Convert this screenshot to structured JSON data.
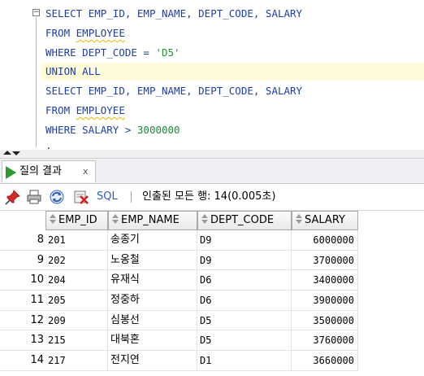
{
  "editor": {
    "lines": [
      {
        "segments": [
          {
            "t": "SELECT ",
            "c": "kw"
          },
          {
            "t": "EMP_ID, EMP_NAME, DEPT_CODE, SALARY",
            "c": "id"
          }
        ]
      },
      {
        "segments": [
          {
            "t": "FROM ",
            "c": "kw"
          },
          {
            "t": "EMPLOYEE",
            "c": "id squig"
          }
        ]
      },
      {
        "segments": [
          {
            "t": "WHERE ",
            "c": "kw"
          },
          {
            "t": "DEPT_CODE = ",
            "c": "id"
          },
          {
            "t": "'D5'",
            "c": "str"
          }
        ]
      },
      {
        "segments": [
          {
            "t": "UNION ALL",
            "c": "kw"
          }
        ],
        "highlight": true
      },
      {
        "segments": [
          {
            "t": "SELECT ",
            "c": "kw"
          },
          {
            "t": "EMP_ID, EMP_NAME, DEPT_CODE, SALARY",
            "c": "id"
          }
        ]
      },
      {
        "segments": [
          {
            "t": "FROM ",
            "c": "kw"
          },
          {
            "t": "EMPLOYEE",
            "c": "id squig"
          }
        ]
      },
      {
        "segments": [
          {
            "t": "WHERE ",
            "c": "kw"
          },
          {
            "t": "SALARY > ",
            "c": "id"
          },
          {
            "t": "3000000",
            "c": "num"
          }
        ]
      },
      {
        "segments": [
          {
            "t": ";",
            "c": "id"
          }
        ]
      }
    ],
    "fold_symbol": "−"
  },
  "tab": {
    "label": "질의 결과",
    "close": "x"
  },
  "toolbar": {
    "sql_label": "SQL",
    "status": "인출된 모든 행: 14(0.005초)",
    "icons": [
      "pin-icon",
      "print-icon",
      "refresh-icon",
      "clear-icon"
    ]
  },
  "grid": {
    "columns": [
      "EMP_ID",
      "EMP_NAME",
      "DEPT_CODE",
      "SALARY"
    ],
    "rows": [
      {
        "rownum": "8",
        "emp_id": "201",
        "emp_name": "송종기",
        "dept_code": "D9",
        "salary": "6000000"
      },
      {
        "rownum": "9",
        "emp_id": "202",
        "emp_name": "노옹철",
        "dept_code": "D9",
        "salary": "3700000"
      },
      {
        "rownum": "10",
        "emp_id": "204",
        "emp_name": "유재식",
        "dept_code": "D6",
        "salary": "3400000"
      },
      {
        "rownum": "11",
        "emp_id": "205",
        "emp_name": "정중하",
        "dept_code": "D6",
        "salary": "3900000"
      },
      {
        "rownum": "12",
        "emp_id": "209",
        "emp_name": "심봉선",
        "dept_code": "D5",
        "salary": "3500000"
      },
      {
        "rownum": "13",
        "emp_id": "215",
        "emp_name": "대북혼",
        "dept_code": "D5",
        "salary": "3760000"
      },
      {
        "rownum": "14",
        "emp_id": "217",
        "emp_name": "전지연",
        "dept_code": "D1",
        "salary": "3660000"
      }
    ]
  },
  "colors": {
    "keyword": "#1f3ea8",
    "string": "#2c8d3a",
    "number": "#1f8a3c",
    "current_line": "#fdfbd8",
    "run_green": "#2e9a2e",
    "link_blue": "#2a5fc2"
  }
}
